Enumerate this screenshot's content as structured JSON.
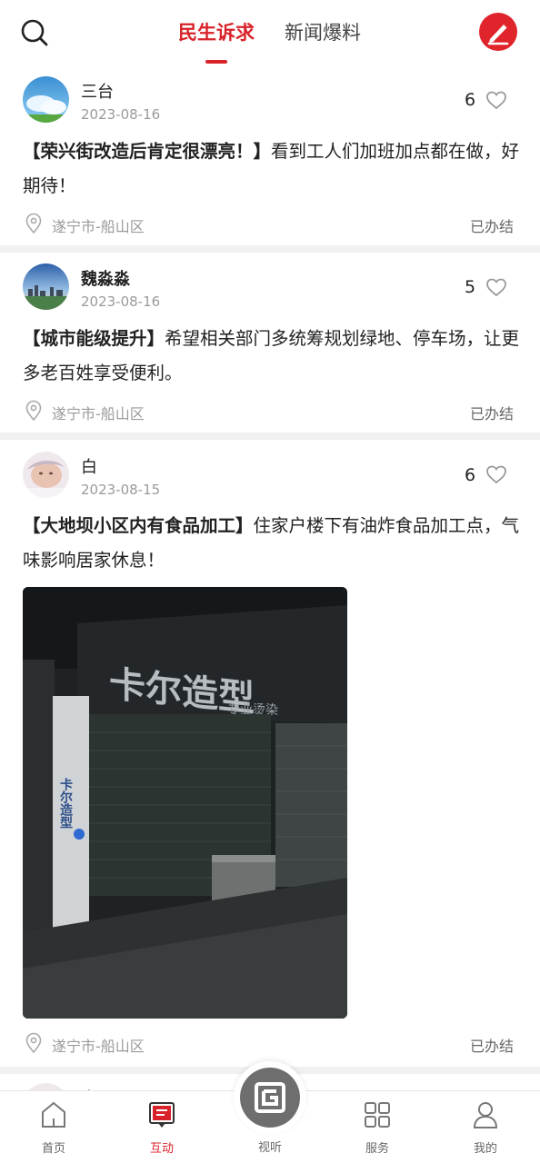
{
  "header": {
    "tabs": [
      {
        "label": "民生诉求",
        "active": true
      },
      {
        "label": "新闻爆料",
        "active": false
      }
    ],
    "accent_color": "#d8232a"
  },
  "posts": [
    {
      "user": "三台",
      "date": "2023-08-16",
      "likes": "6",
      "title": "【荣兴街改造后肯定很漂亮！】",
      "body": "看到工人们加班加点都在做，好期待！",
      "location": "遂宁市-船山区",
      "status": "已办结"
    },
    {
      "user": "魏淼淼",
      "date": "2023-08-16",
      "likes": "5",
      "title": "【城市能级提升】",
      "body": "希望相关部门多统筹规划绿地、停车场，让更多老百姓享受便利。",
      "location": "遂宁市-船山区",
      "status": "已办结"
    },
    {
      "user": "白",
      "date": "2023-08-15",
      "likes": "6",
      "title": "【大地坝小区内有食品加工】",
      "body": "住家户楼下有油炸食品加工点，气味影响居家休息！",
      "location": "遂宁市-船山区",
      "status": "已办结",
      "photo_sign": "卡尔造型",
      "photo_sign_sub": "专业烫染",
      "photo_banner": "卡尔造型"
    },
    {
      "user": "白"
    }
  ],
  "bottom_nav": {
    "items": [
      {
        "label": "首页"
      },
      {
        "label": "互动",
        "active": true
      },
      {
        "label": "视听"
      },
      {
        "label": "服务"
      },
      {
        "label": "我的"
      }
    ]
  }
}
